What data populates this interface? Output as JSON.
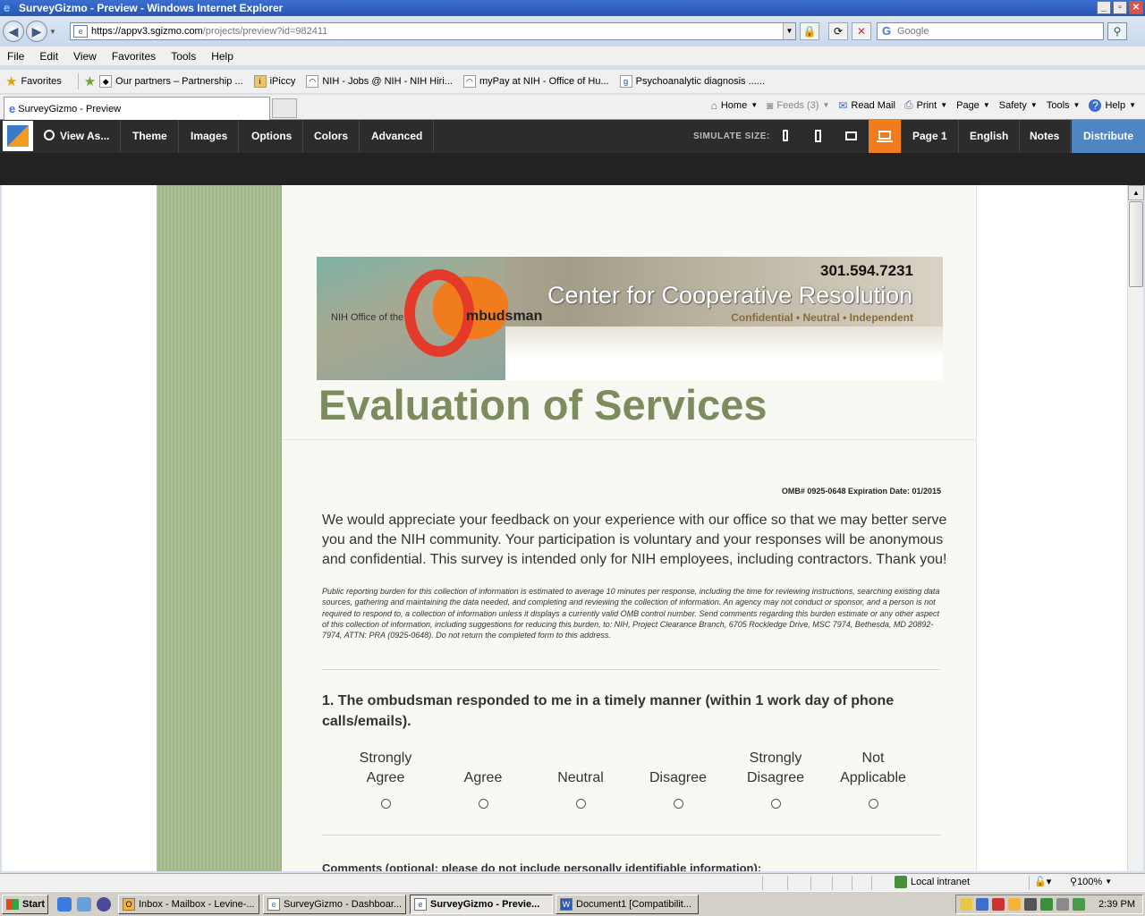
{
  "window": {
    "title": "SurveyGizmo - Preview - Windows Internet Explorer",
    "controls": [
      "_",
      "▫",
      "✕"
    ]
  },
  "address_bar": {
    "url_domain": "https://appv3.sgizmo.com",
    "url_rest": "/projects/preview?id=982411",
    "search_placeholder": "Google"
  },
  "menu": [
    "File",
    "Edit",
    "View",
    "Favorites",
    "Tools",
    "Help"
  ],
  "favorites_bar": {
    "favorites_label": "Favorites",
    "items": [
      "Our partners – Partnership ...",
      "iPiccy",
      "NIH - Jobs @ NIH - NIH Hiri...",
      "myPay at NIH - Office of Hu...",
      "Psychoanalytic diagnosis ......"
    ]
  },
  "tab": {
    "title": "SurveyGizmo - Preview"
  },
  "command_bar": {
    "home": "Home",
    "feeds": "Feeds (3)",
    "read_mail": "Read Mail",
    "print": "Print",
    "page": "Page",
    "safety": "Safety",
    "tools": "Tools",
    "help": "Help"
  },
  "sg_toolbar": {
    "view_as": "View As...",
    "theme": "Theme",
    "images": "Images",
    "options": "Options",
    "colors": "Colors",
    "advanced": "Advanced",
    "simulate_label": "SIMULATE SIZE:",
    "page": "Page 1",
    "language": "English",
    "notes": "Notes",
    "distribute": "Distribute"
  },
  "survey": {
    "banner": {
      "phone": "301.594.7231",
      "center_name": "Center for Cooperative Resolution",
      "tagline": "Confidential • Neutral • Independent",
      "nih_office": "NIH Office of the",
      "ombudsman": "mbudsman"
    },
    "title": "Evaluation of Services",
    "omb_line": "OMB# 0925-0648 Expiration Date: 01/2015",
    "intro": "We would appreciate your feedback on your experience with our office so that we may better serve you and the NIH community. Your participation is voluntary and your responses will be anonymous and confidential. This survey is intended only for NIH employees, including contractors. Thank you!",
    "burden": "Public reporting burden for this collection of information is estimated to average 10 minutes per response, including the time for reviewing instructions, searching existing data sources, gathering and maintaining the data needed, and completing and reviewing the collection of information. An agency may not conduct or sponsor, and a person is not required to respond to, a collection of information unless it displays a currently valid OMB control number. Send comments regarding this burden estimate or any other aspect of this collection of information, including suggestions for reducing this burden, to: NIH, Project Clearance Branch, 6705 Rockledge Drive, MSC 7974, Bethesda, MD 20892-7974, ATTN: PRA (0925-0648). Do not return the completed form to this address.",
    "question1": "1. The ombudsman responded to me in a timely manner (within 1 work day of phone calls/emails).",
    "scale": [
      "Strongly Agree",
      "Agree",
      "Neutral",
      "Disagree",
      "Strongly Disagree",
      "Not Applicable"
    ],
    "comments_label": "Comments (optional; please do not include personally identifiable information):"
  },
  "status_bar": {
    "zone": "Local intranet",
    "zoom": "100%"
  },
  "taskbar": {
    "start": "Start",
    "tasks": [
      "Inbox - Mailbox - Levine-...",
      "SurveyGizmo - Dashboar...",
      "SurveyGizmo - Previe...",
      "Document1 [Compatibilit..."
    ],
    "clock": "2:39 PM"
  },
  "colors": {
    "accent_orange": "#f07c1e",
    "distribute_blue": "#4e86c4",
    "title_green": "#7d8c5e",
    "stripe_green": "#a7bd8f"
  }
}
